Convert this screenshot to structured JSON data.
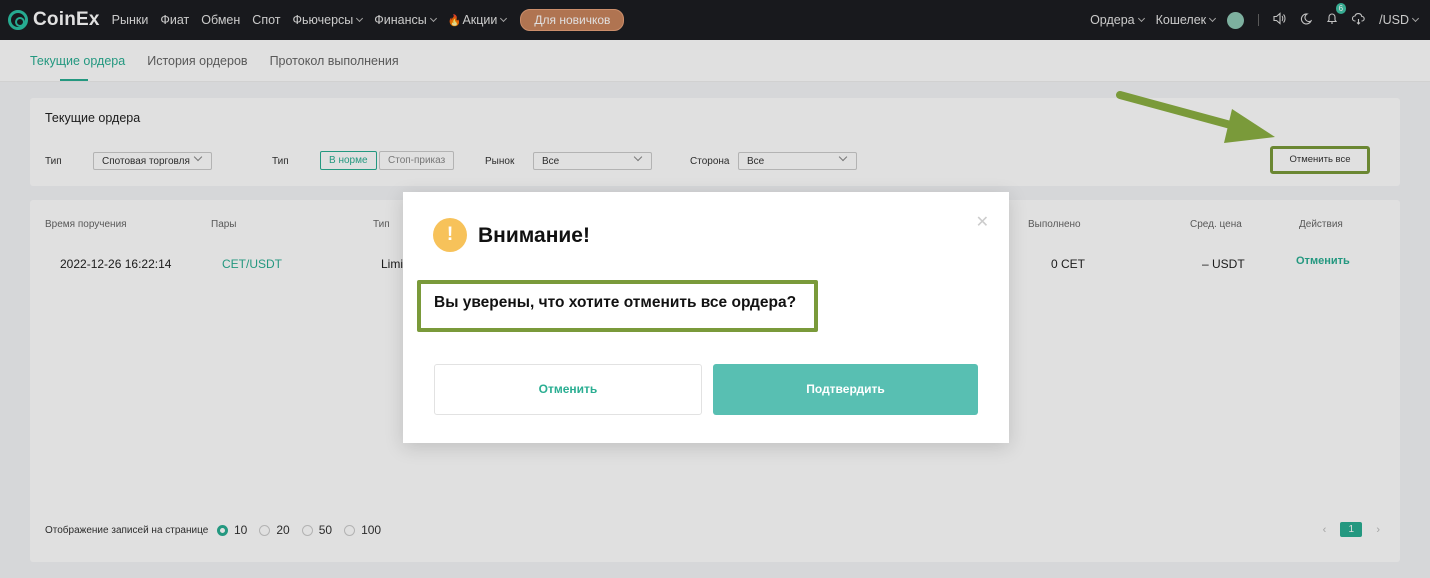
{
  "nav": {
    "logo": "CoinEx",
    "items": [
      "Рынки",
      "Фиат",
      "Обмен",
      "Спот",
      "Фьючерсы",
      "Финансы",
      "Акции"
    ],
    "newbie": "Для новичков",
    "orders": "Ордера",
    "wallet": "Кошелек",
    "notification_count": "6",
    "currency": "/USD"
  },
  "subtabs": [
    "Текущие ордера",
    "История ордеров",
    "Протокол выполнения"
  ],
  "filters": {
    "title": "Текущие ордера",
    "type_label": "Тип",
    "type_value": "Спотовая торговля",
    "type2_label": "Тип",
    "seg_normal": "В норме",
    "seg_stop": "Стоп-приказ",
    "market_label": "Рынок",
    "market_value": "Все",
    "side_label": "Сторона",
    "side_value": "Все",
    "cancel_all": "Отменить все"
  },
  "table": {
    "headers": {
      "time": "Время поручения",
      "pair": "Пары",
      "type": "Тип",
      "filled": "Выполнено",
      "avg_price": "Сред. цена",
      "actions": "Действия"
    },
    "row": {
      "time": "2022-12-26 16:22:14",
      "pair": "CET/USDT",
      "type": "Limi",
      "filled": "0 CET",
      "avg_price": "– USDT",
      "action": "Отменить"
    }
  },
  "pager": {
    "label": "Отображение записей на странице",
    "options": [
      "10",
      "20",
      "50",
      "100"
    ],
    "selected": "10",
    "current_page": "1"
  },
  "modal": {
    "icon": "!",
    "title": "Внимание!",
    "message": "Вы уверены, что хотите отменить все ордера?",
    "cancel": "Отменить",
    "confirm": "Подтвердить"
  },
  "colors": {
    "accent": "#2aae92",
    "confirm": "#58bfb2",
    "annotation": "#7a9a3a",
    "warning": "#f7c25a"
  }
}
